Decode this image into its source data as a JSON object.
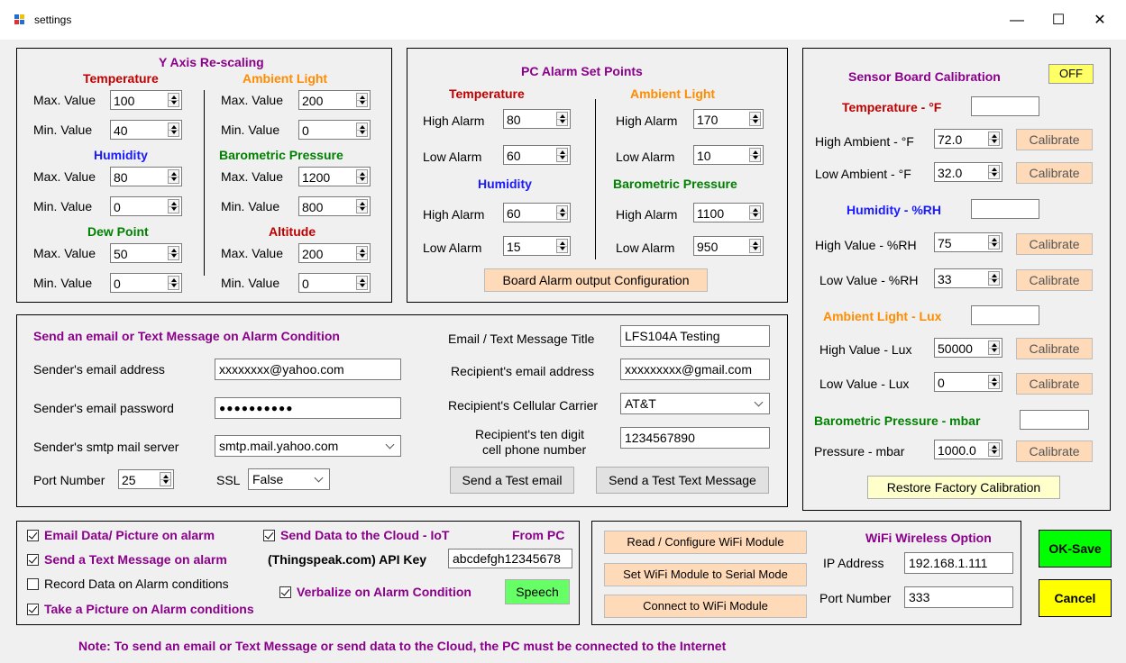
{
  "window": {
    "title": "settings",
    "minimize": "—",
    "maximize": "☐",
    "close": "✕"
  },
  "y_axis": {
    "title": "Y Axis Re-scaling",
    "temperature": {
      "title": "Temperature",
      "max_label": "Max. Value",
      "max": "100",
      "min_label": "Min. Value",
      "min": "40"
    },
    "humidity": {
      "title": "Humidity",
      "max_label": "Max. Value",
      "max": "80",
      "min_label": "Min. Value",
      "min": "0"
    },
    "dew_point": {
      "title": "Dew Point",
      "max_label": "Max. Value",
      "max": "50",
      "min_label": "Min. Value",
      "min": "0"
    },
    "ambient_light": {
      "title": "Ambient Light",
      "max_label": "Max. Value",
      "max": "200",
      "min_label": "Min. Value",
      "min": "0"
    },
    "barometric": {
      "title": "Barometric Pressure",
      "max_label": "Max. Value",
      "max": "1200",
      "min_label": "Min. Value",
      "min": "800"
    },
    "altitude": {
      "title": "Altitude",
      "max_label": "Max. Value",
      "max": "200",
      "min_label": "Min. Value",
      "min": "0"
    }
  },
  "pc_alarm": {
    "title": "PC Alarm Set Points",
    "temperature": {
      "title": "Temperature",
      "high_label": "High Alarm",
      "high": "80",
      "low_label": "Low Alarm",
      "low": "60"
    },
    "humidity": {
      "title": "Humidity",
      "high_label": "High Alarm",
      "high": "60",
      "low_label": "Low Alarm",
      "low": "15"
    },
    "ambient_light": {
      "title": "Ambient Light",
      "high_label": "High Alarm",
      "high": "170",
      "low_label": "Low Alarm",
      "low": "10"
    },
    "barometric": {
      "title": "Barometric Pressure",
      "high_label": "High Alarm",
      "high": "1100",
      "low_label": "Low Alarm",
      "low": "950"
    },
    "board_button": "Board Alarm output Configuration"
  },
  "calibration": {
    "title": "Sensor Board Calibration",
    "state": "OFF",
    "temperature": {
      "title": "Temperature - °F",
      "high_label": "High Ambient - °F",
      "high": "72.0",
      "low_label": "Low Ambient - °F",
      "low": "32.0"
    },
    "humidity": {
      "title": "Humidity - %RH",
      "high_label": "High Value - %RH",
      "high": "75",
      "low_label": "Low Value - %RH",
      "low": "33"
    },
    "light": {
      "title": "Ambient Light - Lux",
      "high_label": "High Value - Lux",
      "high": "50000",
      "low_label": "Low Value - Lux",
      "low": "0"
    },
    "pressure": {
      "title": "Barometric Pressure - mbar",
      "label": "Pressure - mbar",
      "value": "1000.0"
    },
    "calibrate": "Calibrate",
    "restore": "Restore Factory Calibration"
  },
  "email": {
    "title": "Send an email or Text Message on Alarm Condition",
    "sender_label": "Sender's email address",
    "sender": "xxxxxxxx@yahoo.com",
    "password_label": "Sender's email password",
    "password": "●●●●●●●●●●",
    "smtp_label": "Sender's smtp mail server",
    "smtp": "smtp.mail.yahoo.com",
    "port_label": "Port Number",
    "port": "25",
    "ssl_label": "SSL",
    "ssl": "False",
    "msg_title_label": "Email / Text Message Title",
    "msg_title": "LFS104A Testing",
    "recipient_label": "Recipient's email address",
    "recipient": "xxxxxxxxx@gmail.com",
    "carrier_label": "Recipient's Cellular Carrier",
    "carrier": "AT&T",
    "phone_label_1": "Recipient's ten digit",
    "phone_label_2": "cell phone number",
    "phone": "1234567890",
    "test_email": "Send a Test email",
    "test_text": "Send a Test Text Message"
  },
  "options": {
    "email_data": "Email Data/ Picture on alarm",
    "send_text": "Send a Text Message on alarm",
    "record": "Record Data on Alarm conditions",
    "picture": "Take a Picture on Alarm conditions",
    "cloud": "Send Data to the Cloud - IoT",
    "from_pc": "From PC",
    "api_label": "(Thingspeak.com) API Key",
    "api_key": "abcdefgh12345678",
    "verbalize": "Verbalize on Alarm Condition",
    "speech": "Speech"
  },
  "wifi": {
    "read_btn": "Read / Configure WiFi Module",
    "serial_btn": "Set WiFi Module to Serial Mode",
    "connect_btn": "Connect to WiFi Module",
    "title": "WiFi Wireless Option",
    "ip_label": "IP Address",
    "ip": "192.168.1.111",
    "port_label": "Port Number",
    "port": "333"
  },
  "ok": "OK-Save",
  "cancel": "Cancel",
  "note": "Note: To send an email or Text Message or send data to the Cloud, the PC must be connected to the Internet",
  "colors": {
    "temperature": "#c00000",
    "light": "#ff8c00",
    "humidity": "#1a1aff",
    "pressure": "#008000",
    "purple": "#8b008b",
    "ok": "#00ff00",
    "cancel": "#ffff00",
    "off": "#ffff66",
    "peach": "#ffdab9",
    "speech": "#66ff66"
  }
}
